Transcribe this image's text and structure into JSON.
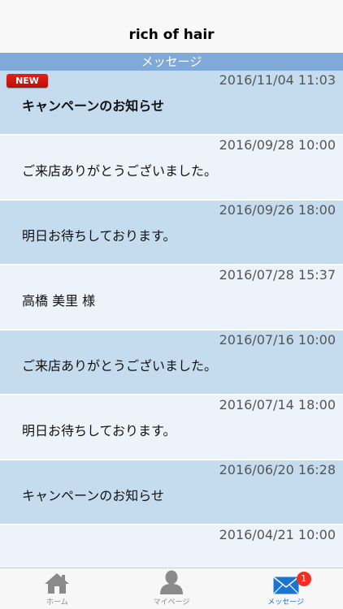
{
  "header": {
    "title": "rich of hair"
  },
  "section": {
    "title": "メッセージ"
  },
  "messages": [
    {
      "date": "2016/11/04 11:03",
      "subject": "キャンペーンのお知らせ",
      "new": "NEW"
    },
    {
      "date": "2016/09/28 10:00",
      "subject": "ご来店ありがとうございました。"
    },
    {
      "date": "2016/09/26 18:00",
      "subject": "明日お待ちしております。"
    },
    {
      "date": "2016/07/28 15:37",
      "subject": "高橋 美里 様"
    },
    {
      "date": "2016/07/16 10:00",
      "subject": "ご来店ありがとうございました。"
    },
    {
      "date": "2016/07/14 18:00",
      "subject": "明日お待ちしております。"
    },
    {
      "date": "2016/06/20 16:28",
      "subject": "キャンペーンのお知らせ"
    },
    {
      "date": "2016/04/21 10:00",
      "subject": ""
    }
  ],
  "tabs": [
    {
      "label": "ホーム",
      "icon": "home-icon"
    },
    {
      "label": "マイページ",
      "icon": "person-icon"
    },
    {
      "label": "メッセージ",
      "icon": "mail-icon",
      "badge": "1"
    }
  ],
  "colors": {
    "section_header": "#7fa9d9",
    "row_dark": "#c5dcef",
    "row_light": "#ecf3fb",
    "active_tab": "#1a75d2",
    "badge": "#f0311f"
  }
}
